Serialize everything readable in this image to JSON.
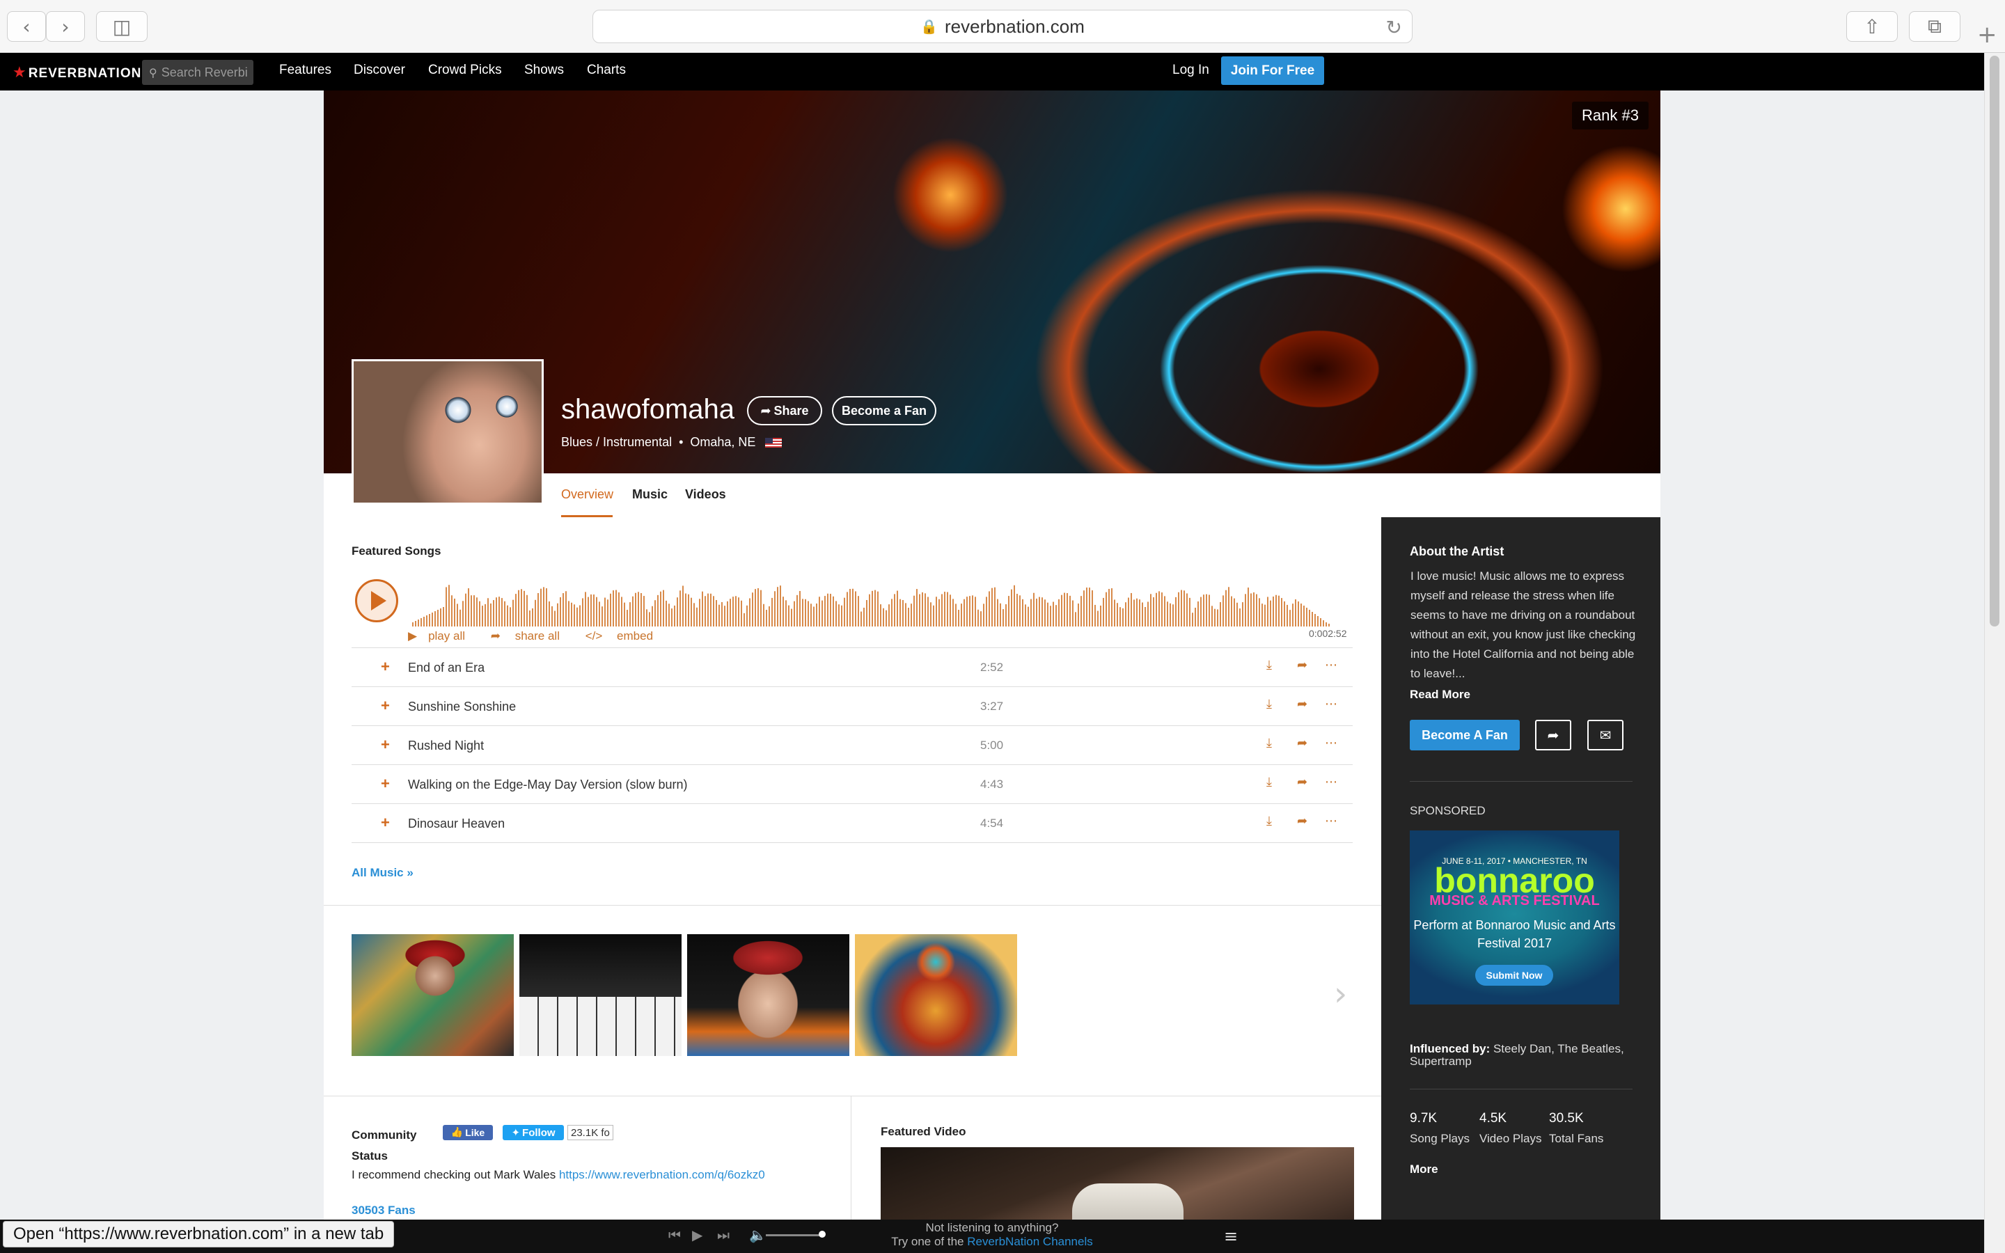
{
  "browser": {
    "url": "reverbnation.com",
    "status_text": "Open “https://www.reverbnation.com” in a new tab"
  },
  "nav": {
    "logo": "REVERBNATION",
    "search_placeholder": "Search Reverbi",
    "links": [
      "Features",
      "Discover",
      "Crowd Picks",
      "Shows",
      "Charts"
    ],
    "login": "Log In",
    "join": "Join For Free"
  },
  "artist": {
    "rank": "Rank #3",
    "name": "shawofomaha",
    "share_label": "Share",
    "fan_label": "Become a Fan",
    "genre": "Blues / Instrumental",
    "location": "Omaha, NE",
    "tabs": [
      "Overview",
      "Music",
      "Videos"
    ]
  },
  "songs": {
    "title": "Featured Songs",
    "play_all": "play all",
    "share_all": "share all",
    "embed": "embed",
    "time_start": "0:00",
    "time_end": "2:52",
    "tracks": [
      {
        "name": "End of an Era",
        "duration": "2:52"
      },
      {
        "name": "Sunshine Sonshine",
        "duration": "3:27"
      },
      {
        "name": "Rushed Night",
        "duration": "5:00"
      },
      {
        "name": "Walking on the Edge-May Day Version (slow burn)",
        "duration": "4:43"
      },
      {
        "name": "Dinosaur Heaven",
        "duration": "4:54"
      }
    ],
    "all_music": "All Music »"
  },
  "community": {
    "title_line1": "Community",
    "title_line2": "Status",
    "fb_like": "Like",
    "tw_follow": "Follow",
    "tw_count": "23.1K fo",
    "status_text": "I recommend checking out Mark Wales",
    "status_link": "https://www.reverbnation.com/q/6ozkz0",
    "fans": "30503 Fans"
  },
  "featured_video": {
    "title": "Featured Video"
  },
  "sidebar": {
    "about_title": "About the Artist",
    "about_text": "I love music! Music allows me to express myself and release the stress when life seems to have me driving on a roundabout without an exit, you know just like checking into the Hotel California and not being able to leave!...",
    "read_more": "Read More",
    "become_fan": "Become A Fan",
    "sponsored": "SPONSORED",
    "ad_date": "JUNE 8-11, 2017 • MANCHESTER, TN",
    "ad_logo": "bonnaroo",
    "ad_sub": "MUSIC & ARTS FESTIVAL",
    "ad_text": "Perform at Bonnaroo Music and Arts Festival 2017",
    "ad_button": "Submit Now",
    "influenced_label": "Influenced by:",
    "influenced_value": "Steely Dan, The Beatles, Supertramp",
    "stats": [
      {
        "value": "9.7K",
        "label": "Song Plays"
      },
      {
        "value": "4.5K",
        "label": "Video Plays"
      },
      {
        "value": "30.5K",
        "label": "Total Fans"
      }
    ],
    "more": "More"
  },
  "player": {
    "line1": "Not listening to anything?",
    "line2_prefix": "Try one of the",
    "line2_link": "ReverbNation Channels"
  },
  "colors": {
    "accent": "#d2691e",
    "link": "#2a8fd6",
    "sidebar_bg": "#242424"
  }
}
